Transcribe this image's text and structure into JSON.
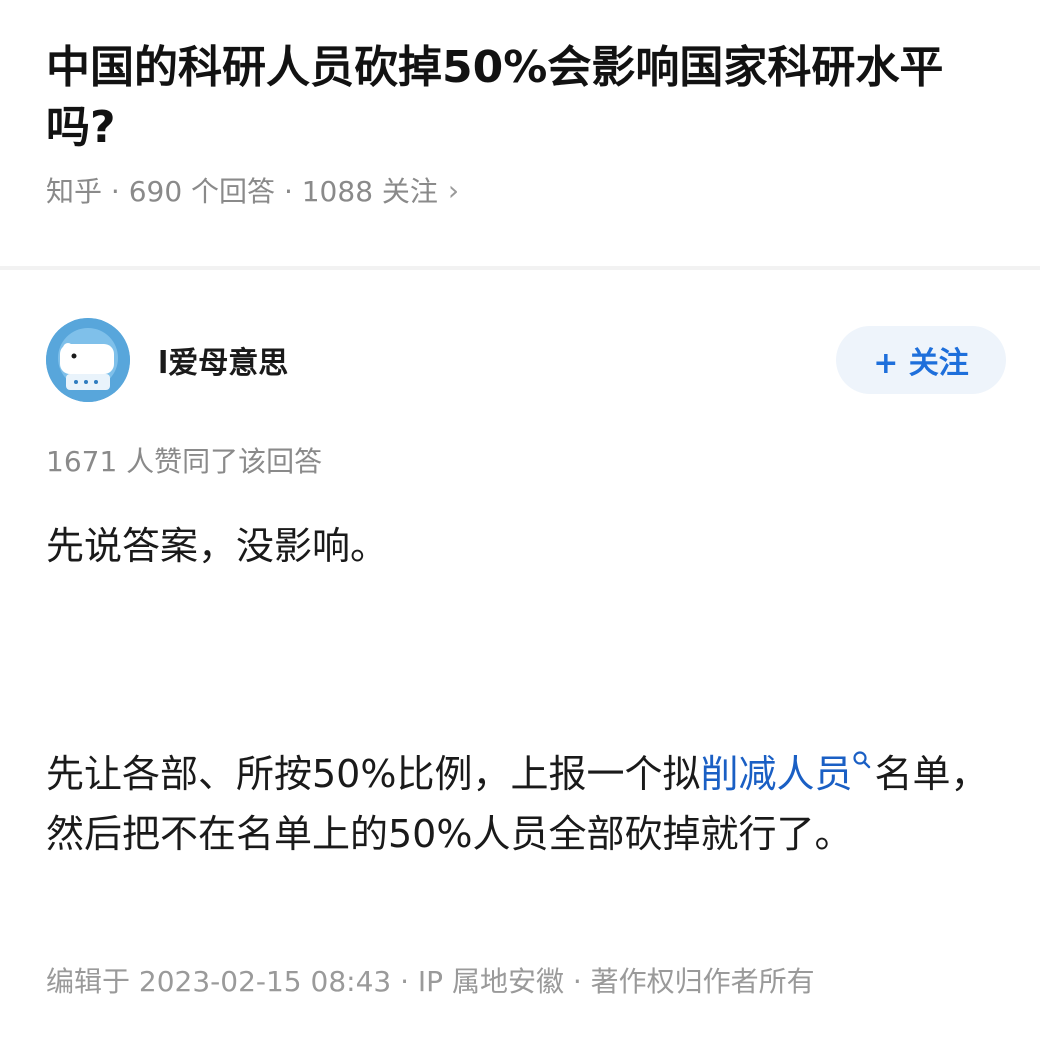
{
  "question": {
    "title": "中国的科研人员砍掉50%会影响国家科研水平吗?",
    "meta": "知乎 · 690 个回答 · 1088 关注",
    "chevron": "›"
  },
  "author": {
    "name": "l爱母意思",
    "follow_label": "+ 关注"
  },
  "answer": {
    "votes": "1671 人赞同了该回答",
    "paragraph1": "先说答案，没影响。",
    "p2_before": "先让各部、所按50%比例，上报一个拟",
    "p2_link": "削减人员",
    "p2_after": "名单，然后把不在名单上的50%人员全部砍掉就行了。",
    "footer": "编辑于 2023-02-15 08:43 · IP 属地安徽 · 著作权归作者所有"
  },
  "colors": {
    "link": "#1a5fc4",
    "follow_bg": "#eef4fb",
    "follow_text": "#1e6fdb",
    "muted": "#8a8a8a"
  }
}
